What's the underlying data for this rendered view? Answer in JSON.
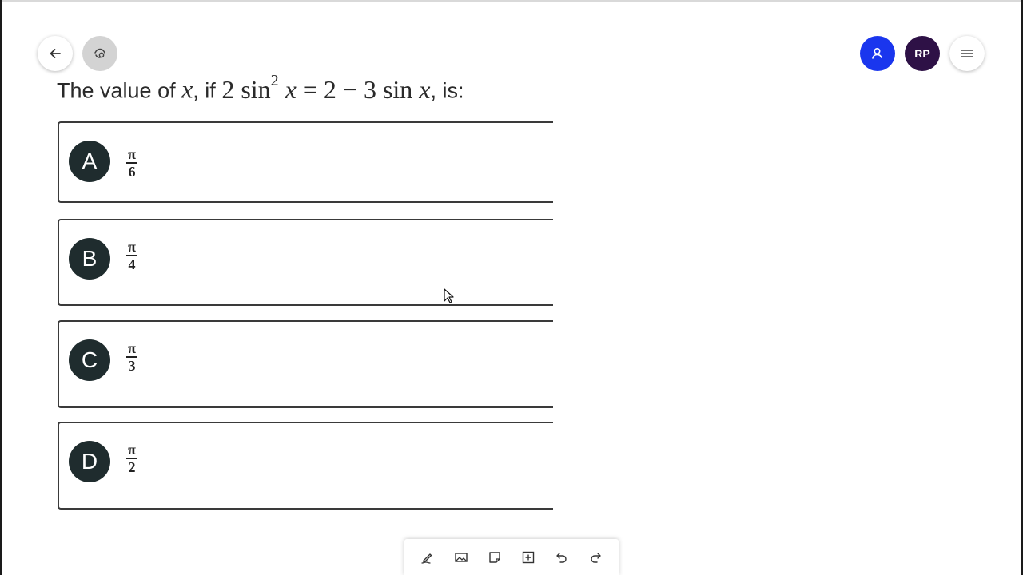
{
  "question": {
    "prefix": "The value of ",
    "var": "x",
    "mid": ", if ",
    "coef": "2",
    "sin1": "sin",
    "exp": "2",
    "var2": "x",
    "rhs": " = 2 − 3",
    "sin2": "sin",
    "var3": "x",
    "suffix": ", is:"
  },
  "header": {
    "avatar_initials": "RP"
  },
  "options": [
    {
      "letter": "A",
      "numerator": "π",
      "denominator": "6"
    },
    {
      "letter": "B",
      "numerator": "π",
      "denominator": "4"
    },
    {
      "letter": "C",
      "numerator": "π",
      "denominator": "3"
    },
    {
      "letter": "D",
      "numerator": "π",
      "denominator": "2"
    }
  ],
  "toolbar": {
    "icons": [
      "pen-icon",
      "image-icon",
      "sticky-note-icon",
      "add-box-icon",
      "undo-icon",
      "redo-icon"
    ]
  },
  "colors": {
    "user_button": "#1a36ee",
    "avatar": "#2e1146",
    "letter_badge": "#1f2c2e"
  }
}
